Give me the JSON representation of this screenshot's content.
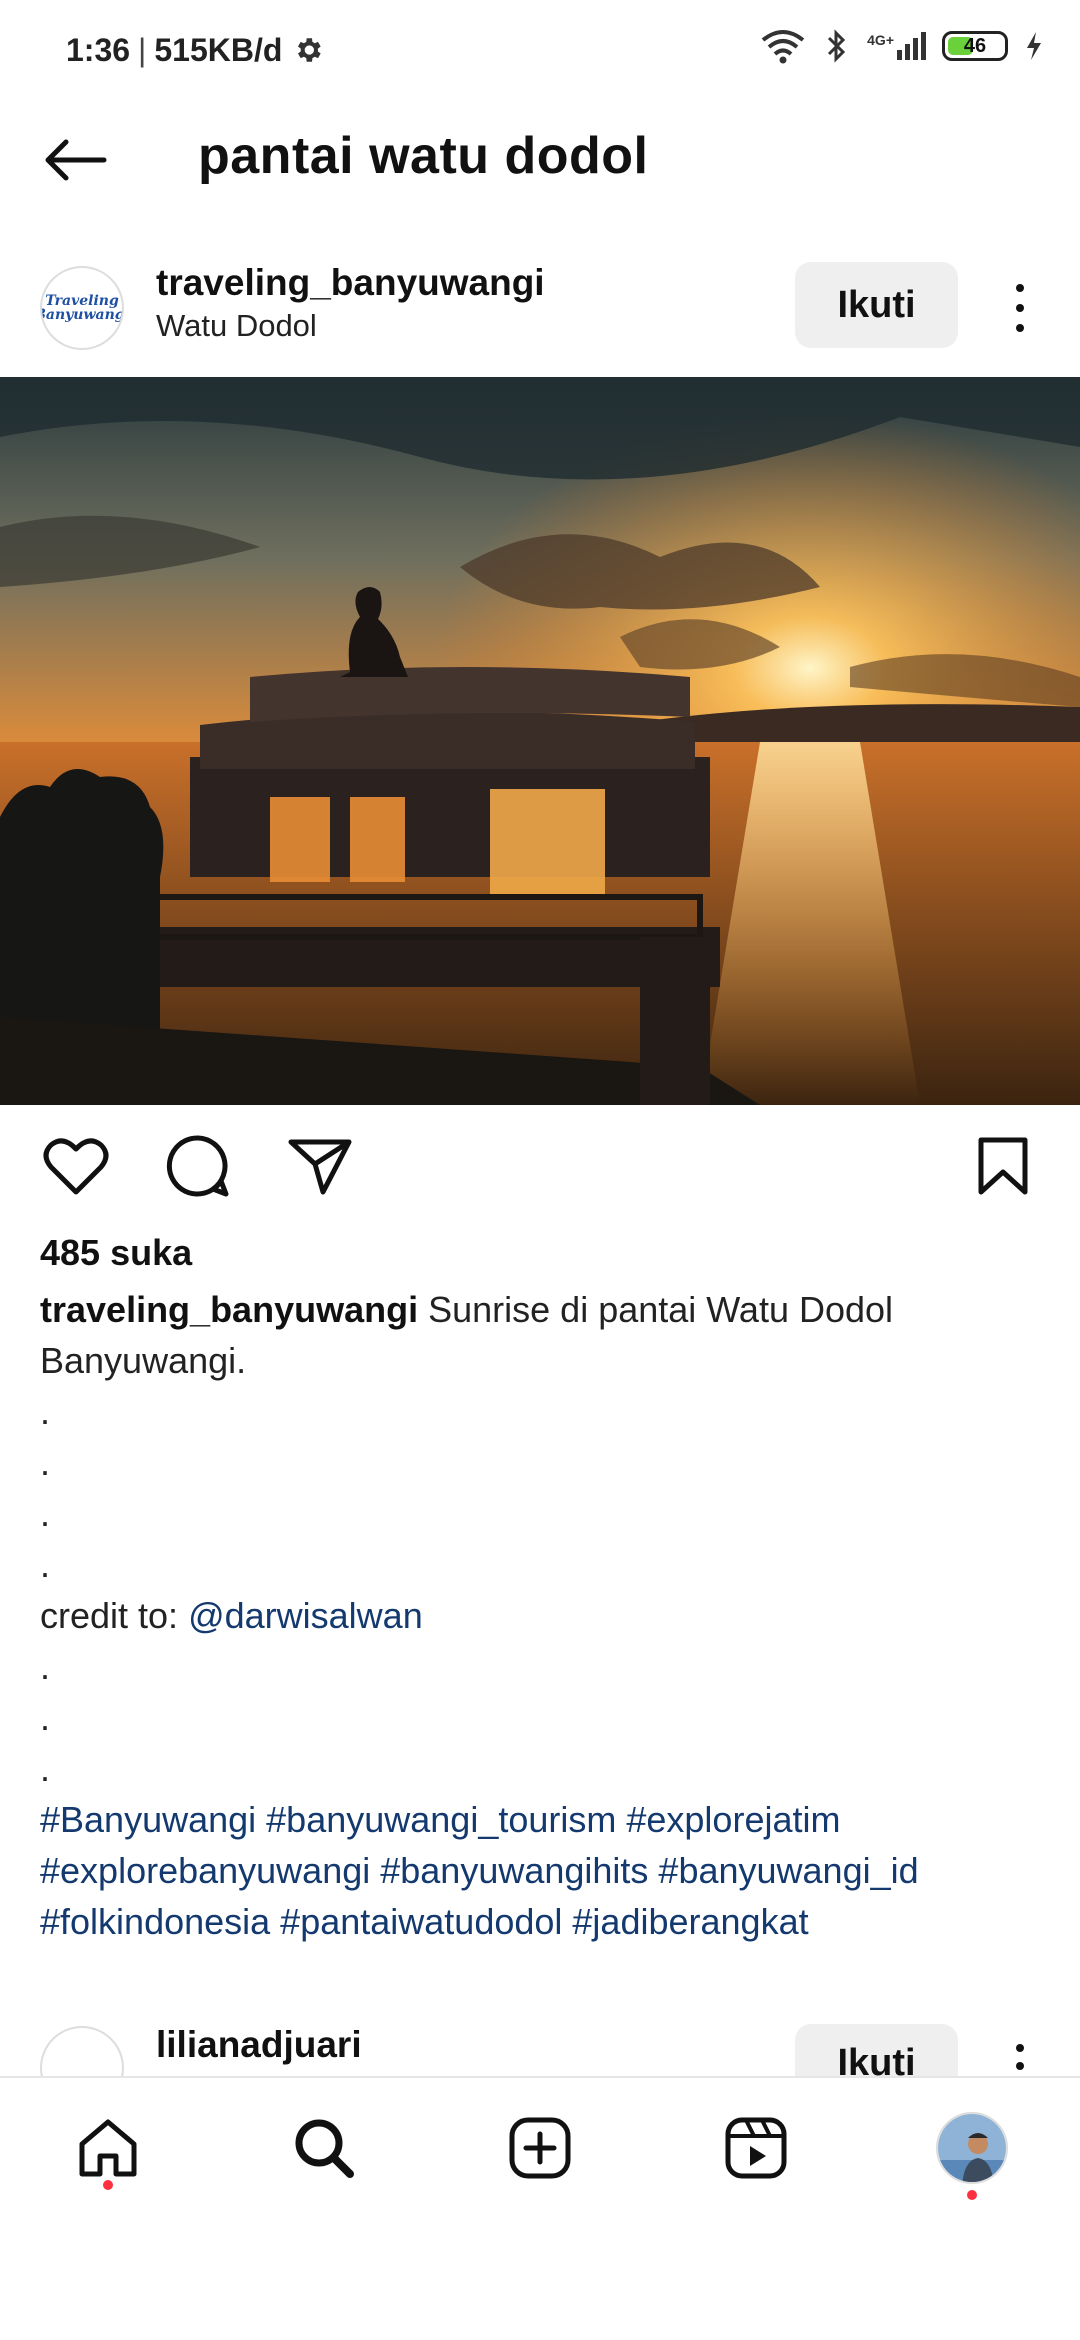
{
  "status_bar": {
    "time": "1:36",
    "separator": "|",
    "speed": "515KB/d",
    "network_label": "4G+",
    "battery": "46",
    "icons": [
      "gear-icon",
      "wifi-icon",
      "bluetooth-icon",
      "signal-icon",
      "battery-icon",
      "charging-icon"
    ]
  },
  "header": {
    "title": "pantai watu dodol"
  },
  "post": {
    "username": "traveling_banyuwangi",
    "location": "Watu Dodol",
    "follow_label": "Ikuti",
    "avatar_text": "Traveling Banyuwangi",
    "likes": "485 suka",
    "caption_user": "traveling_banyuwangi",
    "caption_text": "Sunrise di pantai Watu Dodol Banyuwangi.",
    "dots_a": [
      ".",
      ".",
      ".",
      "."
    ],
    "credit_label": "credit to:",
    "credit_link": "@darwisalwan",
    "dots_b": [
      ".",
      ".",
      "."
    ],
    "hashtags_line1": "#Banyuwangi #banyuwangi_tourism #explorejatim",
    "hashtags_line2": "#explorebanyuwangi #banyuwangihits #banyuwangi_id",
    "hashtags_line3": "#folkindonesia #pantaiwatudodol #jadiberangkat"
  },
  "next_post": {
    "username": "lilianadjuari",
    "follow_label": "Ikuti"
  },
  "bottom_nav": {
    "items": [
      "home-icon",
      "search-icon",
      "create-icon",
      "reels-icon",
      "profile-avatar"
    ],
    "accent": "#ff3040"
  },
  "colors": {
    "link": "#13396e",
    "button_bg": "#efefef"
  }
}
